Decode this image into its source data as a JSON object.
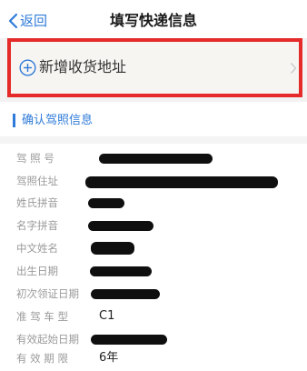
{
  "nav": {
    "back_label": "返回",
    "title": "填写快递信息"
  },
  "address": {
    "add_label": "新增收货地址",
    "plus_icon": "plus-circle-icon",
    "chevron_icon": "chevron-right-icon"
  },
  "section": {
    "title": "确认驾照信息"
  },
  "info_rows": [
    {
      "label": "驾 照 号",
      "value": ""
    },
    {
      "label": "驾照住址",
      "value": ""
    },
    {
      "label": "姓氏拼音",
      "value": ""
    },
    {
      "label": "名字拼音",
      "value": ""
    },
    {
      "label": "中文姓名",
      "value": ""
    },
    {
      "label": "出生日期",
      "value": ""
    },
    {
      "label": "初次领证日期",
      "value": ""
    },
    {
      "label": "准 驾 车 型",
      "value": "C1"
    },
    {
      "label": "有效起始日期",
      "value": ""
    },
    {
      "label": "有 效 期 限",
      "value": "6年"
    }
  ],
  "colors": {
    "accent": "#2f7bd9",
    "highlight_border": "#e52a2a",
    "label_text": "#9a9a9a"
  }
}
